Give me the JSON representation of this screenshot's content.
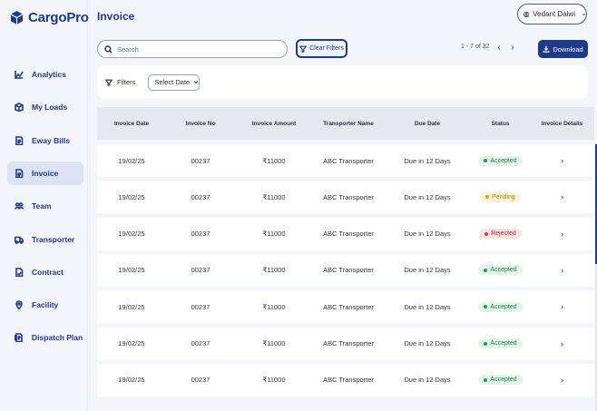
{
  "app": {
    "name": "CargoPro"
  },
  "sidebar": {
    "items": [
      {
        "label": "Analytics",
        "icon": "chart-icon",
        "active": false
      },
      {
        "label": "My Loads",
        "icon": "box-icon",
        "active": false
      },
      {
        "label": "Eway Bills",
        "icon": "document-icon",
        "active": false
      },
      {
        "label": "Invoice",
        "icon": "invoice-icon",
        "active": true
      },
      {
        "label": "Team",
        "icon": "team-icon",
        "active": false
      },
      {
        "label": "Transporter",
        "icon": "truck-icon",
        "active": false
      },
      {
        "label": "Contract",
        "icon": "contract-icon",
        "active": false
      },
      {
        "label": "Facility",
        "icon": "location-pin-icon",
        "active": false
      },
      {
        "label": "Dispatch Plan",
        "icon": "dispatch-icon",
        "active": false
      }
    ]
  },
  "header": {
    "title": "Invoice",
    "user_name": "Vedant Dalwi"
  },
  "toolbar": {
    "search_placeholder": "Search",
    "clear_filters_label": "Clear Filters",
    "pagination": "1 - 7 of 32",
    "download_label": "Download"
  },
  "filters": {
    "label": "Filters",
    "date_select": "Select Date"
  },
  "table": {
    "columns": [
      "Invoice Date",
      "Invoice No",
      "Invoice Amount",
      "Transporter Name",
      "Due Date",
      "Status",
      "Invoice Details"
    ],
    "rows": [
      {
        "date": "19/02/25",
        "number": "00237",
        "amount": "₹11000",
        "transporter": "ABC Transporter",
        "due": "Due in 12 Days",
        "status": "Accepted"
      },
      {
        "date": "19/02/25",
        "number": "00237",
        "amount": "₹11000",
        "transporter": "ABC Transporter",
        "due": "Due in 12 Days",
        "status": "Pending"
      },
      {
        "date": "19/02/25",
        "number": "00237",
        "amount": "₹11000",
        "transporter": "ABC Transporter",
        "due": "Due in 12 Days",
        "status": "Rejected"
      },
      {
        "date": "19/02/25",
        "number": "00237",
        "amount": "₹11000",
        "transporter": "ABC Transporter",
        "due": "Due in 12 Days",
        "status": "Accepted"
      },
      {
        "date": "19/02/25",
        "number": "00237",
        "amount": "₹11000",
        "transporter": "ABC Transporter",
        "due": "Due in 12 Days",
        "status": "Accepted"
      },
      {
        "date": "19/02/25",
        "number": "00237",
        "amount": "₹11000",
        "transporter": "ABC Transporter",
        "due": "Due in 12 Days",
        "status": "Accepted"
      },
      {
        "date": "19/02/25",
        "number": "00237",
        "amount": "₹11000",
        "transporter": "ABC Transporter",
        "due": "Due in 12 Days",
        "status": "Accepted"
      }
    ]
  },
  "status_colors": {
    "Accepted": {
      "bg": "#e3f6ea",
      "fg": "#1f7a45",
      "dot": "#1f9d55"
    },
    "Pending": {
      "bg": "#fdf3d8",
      "fg": "#b07d00",
      "dot": "#e0a800"
    },
    "Rejected": {
      "bg": "#fde4e4",
      "fg": "#c62828",
      "dot": "#e53935"
    }
  },
  "colors": {
    "accent": "#1e3a8a",
    "background": "#f3f5fa"
  }
}
